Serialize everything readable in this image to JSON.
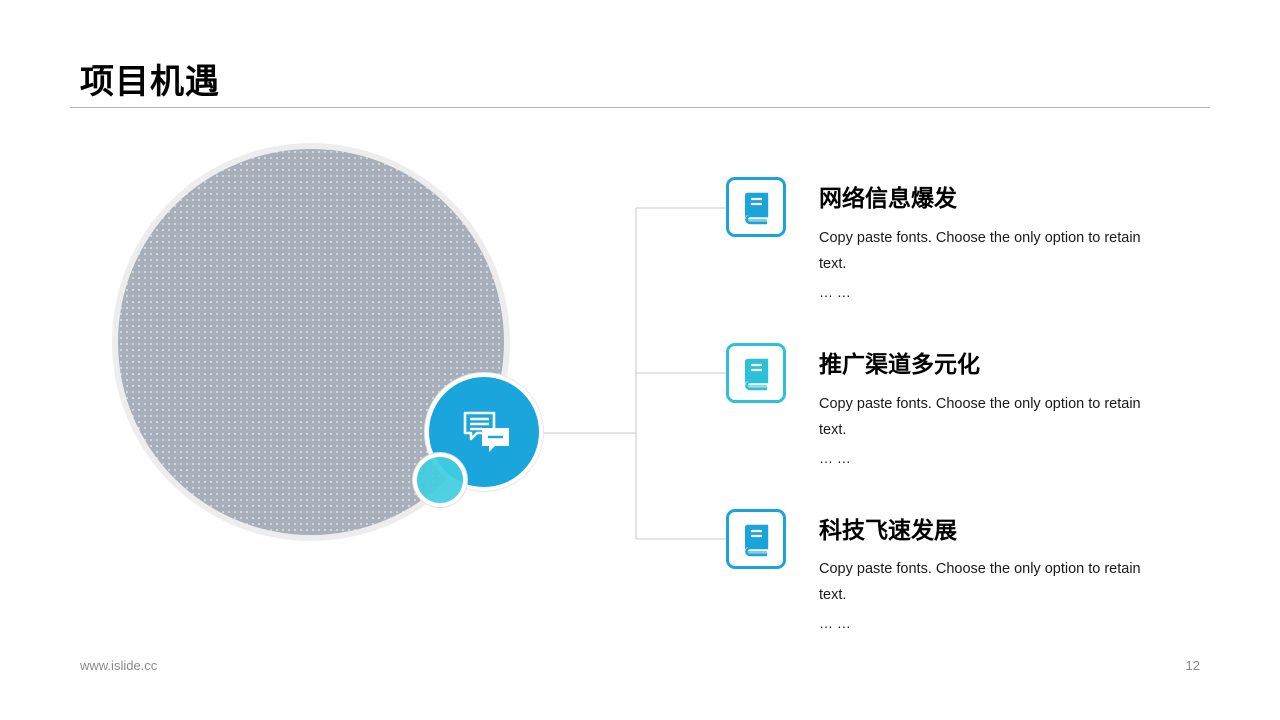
{
  "slide": {
    "title": "项目机遇"
  },
  "hub": {
    "icon": "chat-bubbles-icon",
    "color": "#1aa5dc",
    "accent_color": "#40cde0"
  },
  "items": [
    {
      "icon": "book-icon",
      "title": "网络信息爆发",
      "description": "Copy paste fonts. Choose the only option to retain text.",
      "ellipsis": "… …"
    },
    {
      "icon": "book-icon",
      "title": "推广渠道多元化",
      "description": "Copy paste fonts. Choose the only option to retain text.",
      "ellipsis": "… …"
    },
    {
      "icon": "book-icon",
      "title": "科技飞速发展",
      "description": "Copy paste fonts. Choose the only option to retain text.",
      "ellipsis": "… …"
    }
  ],
  "footer": {
    "url": "www.islide.cc",
    "page_number": "12"
  },
  "colors": {
    "icon_border": "#1ba4da",
    "icon_border_teal": "#2cc1d6",
    "placeholder_circle": "#a7afba",
    "rule": "#b5b5b5"
  }
}
